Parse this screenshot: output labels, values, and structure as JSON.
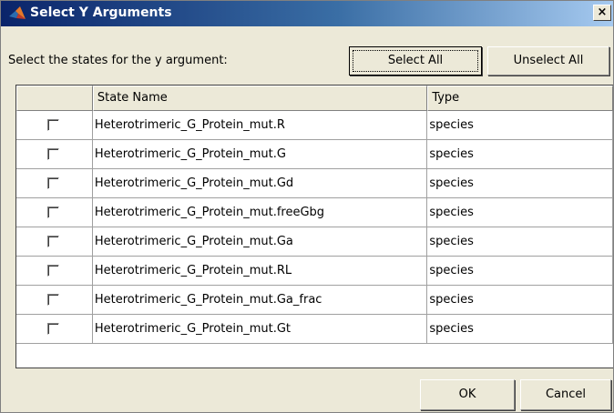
{
  "window": {
    "title": "Select Y Arguments",
    "close_label": "×"
  },
  "prompt": "Select the states for the y argument:",
  "buttons": {
    "select_all": "Select All",
    "unselect_all": "Unselect All",
    "ok": "OK",
    "cancel": "Cancel"
  },
  "table": {
    "columns": [
      "",
      "State Name",
      "Type"
    ],
    "rows": [
      {
        "state": "Heterotrimeric_G_Protein_mut.R",
        "type": "species",
        "checked": false
      },
      {
        "state": "Heterotrimeric_G_Protein_mut.G",
        "type": "species",
        "checked": false
      },
      {
        "state": "Heterotrimeric_G_Protein_mut.Gd",
        "type": "species",
        "checked": false
      },
      {
        "state": "Heterotrimeric_G_Protein_mut.freeGbg",
        "type": "species",
        "checked": false
      },
      {
        "state": "Heterotrimeric_G_Protein_mut.Ga",
        "type": "species",
        "checked": false
      },
      {
        "state": "Heterotrimeric_G_Protein_mut.RL",
        "type": "species",
        "checked": false
      },
      {
        "state": "Heterotrimeric_G_Protein_mut.Ga_frac",
        "type": "species",
        "checked": false
      },
      {
        "state": "Heterotrimeric_G_Protein_mut.Gt",
        "type": "species",
        "checked": false
      }
    ]
  },
  "icons": {
    "title": "matlab-icon",
    "close": "close-icon"
  }
}
